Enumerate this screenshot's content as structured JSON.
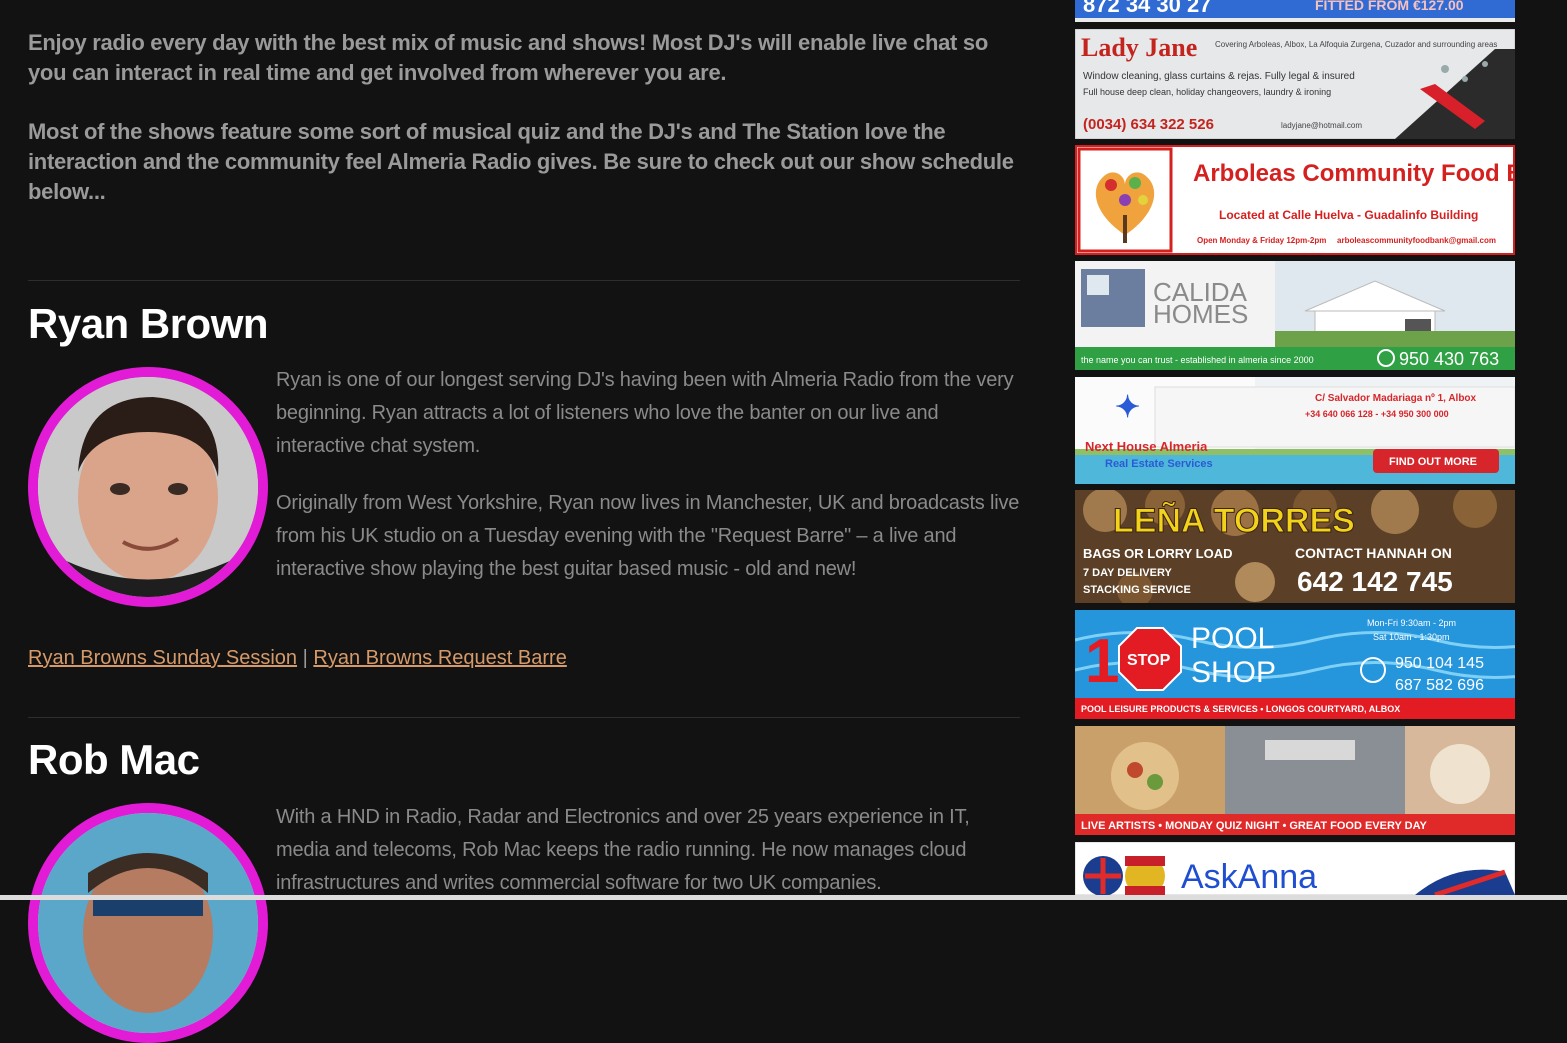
{
  "intro": {
    "p1": "Enjoy radio every day with the best mix of music and shows! Most DJ's will enable live chat so you can interact in real time and get involved from wherever you are.",
    "p2": "Most of the shows feature some sort of musical quiz and the DJ's and The Station love the interaction and the community feel Almeria Radio gives. Be sure to check out our show schedule below..."
  },
  "djs": [
    {
      "name": "Ryan Brown",
      "bio1": "Ryan is one of our longest serving DJ's having been with Almeria Radio from the very beginning. Ryan attracts a lot of listeners who love the banter on our live and interactive chat system.",
      "bio2": "Originally from West Yorkshire, Ryan now lives in Manchester, UK and broadcasts live from his UK studio on a Tuesday evening with the \"Request Barre\" – a live and interactive show playing the best guitar based music - old and new!",
      "link1": "Ryan Browns Sunday Session",
      "separator": "|",
      "link2": "Ryan Browns Request Barre"
    },
    {
      "name": "Rob Mac",
      "bio1": "With a HND in Radio, Radar and Electronics and over 25 years experience in IT, media and telecoms, Rob Mac keeps the radio running. He now manages cloud infrastructures and writes commercial software for two UK companies."
    }
  ],
  "ads": {
    "top": {
      "left": "872 34 30 27",
      "right": "FITTED FROM €127.00"
    },
    "lady_jane": {
      "title": "Lady Jane",
      "sub": "Covering Arboleas, Albox, La Alfoquia Zurgena, Cuzador and surrounding areas",
      "line1": "Window cleaning, glass curtains & rejas. Fully legal & insured",
      "line2": "Full house deep clean, holiday changeovers, laundry & ironing",
      "phone": "(0034) 634 322 526",
      "email": "ladyjane@hotmail.com"
    },
    "food_bank": {
      "title": "Arboleas Community Food Bank",
      "line1": "Located at Calle Huelva - Guadalinfo Building",
      "line2": "Open Monday & Friday 12pm-2pm",
      "email": "arboleascommunityfoodbank@gmail.com"
    },
    "calida": {
      "name1": "CALIDA",
      "name2": "HOMES",
      "tag": "the name you can trust - established in almeria since 2000",
      "phone": "950 430 763"
    },
    "next_house": {
      "address": "C/ Salvador Madariaga nº 1, Albox",
      "phones": "+34 640 066 128 - +34 950 300 000",
      "name1": "Next House Almeria",
      "name2": "Real Estate Services",
      "button": "FIND OUT MORE"
    },
    "lena": {
      "title": "LEÑA TORRES",
      "l1": "BAGS OR LORRY LOAD",
      "l2": "7 DAY DELIVERY",
      "l3": "STACKING SERVICE",
      "contact": "CONTACT HANNAH ON",
      "phone": "642 142 745"
    },
    "pool": {
      "one": "1",
      "stop": "STOP",
      "pool": "POOL",
      "shop": "SHOP",
      "hours1": "Mon-Fri 9:30am - 2pm",
      "hours2": "Sat 10am - 1:30pm",
      "phone1": "950 104 145",
      "phone2": "687 582 696",
      "footer": "POOL LEISURE PRODUCTS & SERVICES • LONGOS COURTYARD, ALBOX"
    },
    "venue": {
      "footer": "LIVE ARTISTS • MONDAY QUIZ NIGHT • GREAT FOOD EVERY DAY"
    },
    "ask_anna": {
      "title": "AskAnna"
    }
  }
}
